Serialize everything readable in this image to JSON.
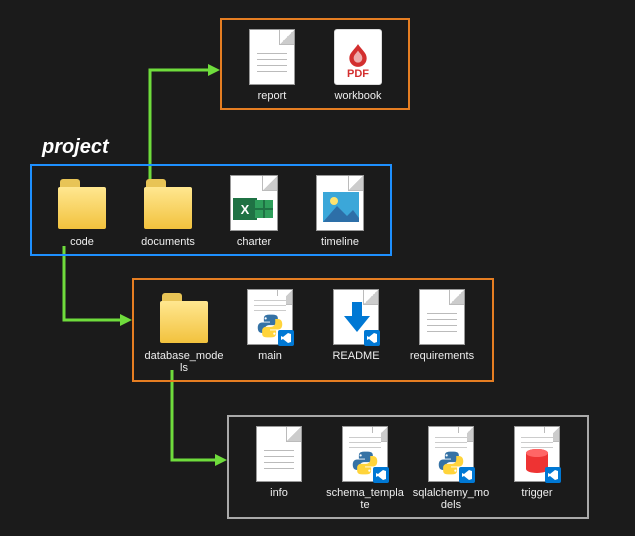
{
  "title": "project",
  "colors": {
    "accent_orange": "#e67e22",
    "accent_blue": "#1e90ff",
    "accent_gray": "#aaaaaa",
    "arrow": "#6fdc3c"
  },
  "project": {
    "label": "project",
    "items": [
      {
        "name": "code",
        "type": "folder"
      },
      {
        "name": "documents",
        "type": "folder"
      },
      {
        "name": "charter",
        "type": "excel"
      },
      {
        "name": "timeline",
        "type": "image"
      }
    ]
  },
  "documents": {
    "items": [
      {
        "name": "report",
        "type": "text"
      },
      {
        "name": "workbook",
        "type": "pdf",
        "badge": "PDF"
      }
    ]
  },
  "code": {
    "items": [
      {
        "name": "database_models",
        "type": "folder"
      },
      {
        "name": "main",
        "type": "python"
      },
      {
        "name": "README",
        "type": "markdown"
      },
      {
        "name": "requirements",
        "type": "text"
      }
    ]
  },
  "database_models": {
    "items": [
      {
        "name": "info",
        "type": "text"
      },
      {
        "name": "schema_template",
        "type": "python"
      },
      {
        "name": "sqlalchemy_models",
        "type": "python"
      },
      {
        "name": "trigger",
        "type": "sql"
      }
    ]
  }
}
